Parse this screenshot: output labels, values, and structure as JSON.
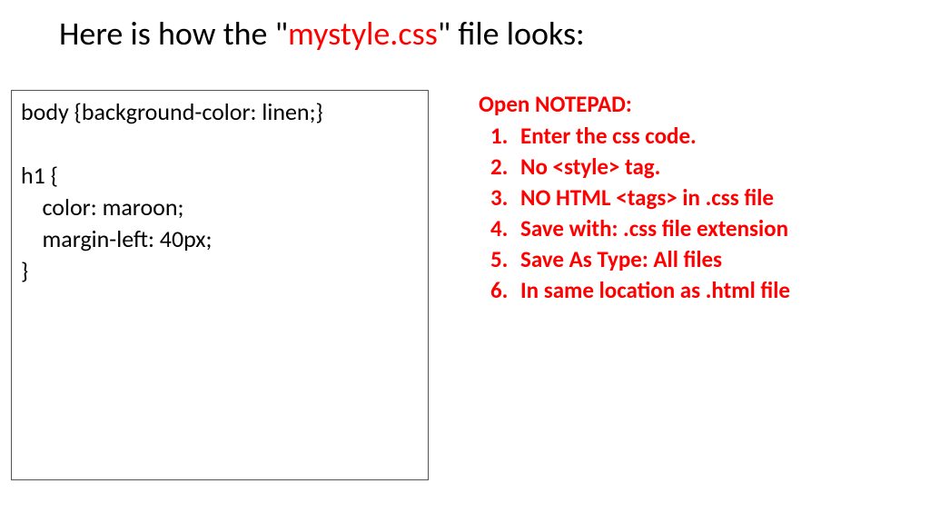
{
  "heading": {
    "pre": "Here is how the \"",
    "filename": "mystyle.css",
    "post": "\" file looks:"
  },
  "code": "body {background-color: linen;}\n\nh1 {\n    color: maroon;\n    margin-left: 40px;\n}",
  "instructions": {
    "title": "Open NOTEPAD:",
    "items": [
      "Enter the css code.",
      "No <style> tag.",
      "NO HTML <tags> in .css file",
      "Save with: .css file extension",
      "Save As Type: All files",
      "In same location as .html file"
    ]
  }
}
